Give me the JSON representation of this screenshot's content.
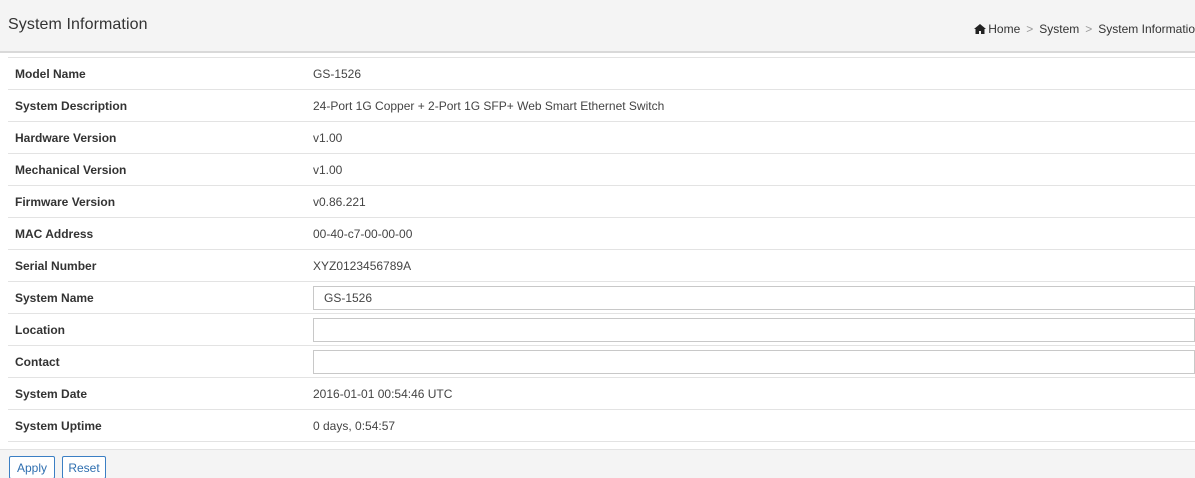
{
  "header": {
    "title": "System Information",
    "breadcrumb": [
      "Home",
      "System",
      "System Informatio"
    ],
    "breadcrumb_separator": ">"
  },
  "rows": [
    {
      "label": "Model Name",
      "value": "GS-1526",
      "type": "text"
    },
    {
      "label": "System Description",
      "value": "24-Port 1G Copper + 2-Port 1G SFP+ Web Smart Ethernet Switch",
      "type": "text"
    },
    {
      "label": "Hardware Version",
      "value": "v1.00",
      "type": "text"
    },
    {
      "label": "Mechanical Version",
      "value": "v1.00",
      "type": "text"
    },
    {
      "label": "Firmware Version",
      "value": "v0.86.221",
      "type": "text"
    },
    {
      "label": "MAC Address",
      "value": "00-40-c7-00-00-00",
      "type": "text"
    },
    {
      "label": "Serial Number",
      "value": "XYZ0123456789A",
      "type": "text"
    },
    {
      "label": "System Name",
      "value": "GS-1526",
      "type": "input"
    },
    {
      "label": "Location",
      "value": "",
      "type": "input"
    },
    {
      "label": "Contact",
      "value": "",
      "type": "input"
    },
    {
      "label": "System Date",
      "value": "2016-01-01 00:54:46 UTC",
      "type": "text"
    },
    {
      "label": "System Uptime",
      "value": "0 days, 0:54:57",
      "type": "text"
    }
  ],
  "buttons": {
    "apply_label": "Apply",
    "reset_label": "Reset"
  },
  "colors": {
    "button_border": "#3b7fc4",
    "button_text": "#2f6fb0",
    "header_background": "#f4f4f4"
  },
  "icons": {
    "home": "home-icon"
  }
}
